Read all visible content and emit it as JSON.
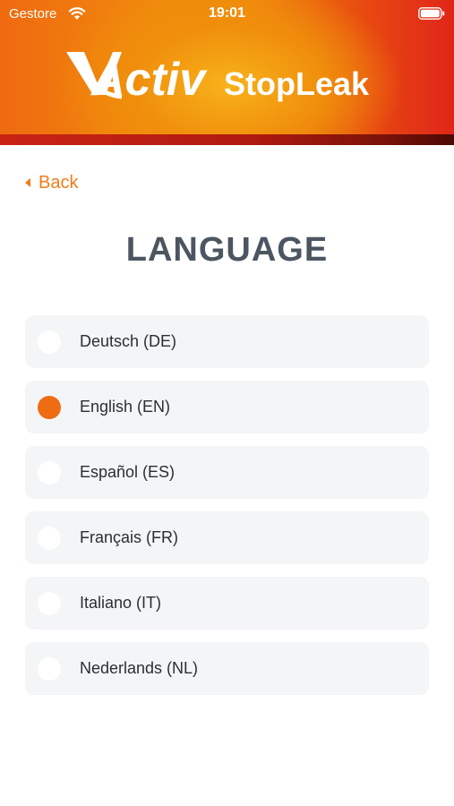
{
  "status_bar": {
    "carrier": "Gestore",
    "time": "19:01"
  },
  "logo": {
    "text_activ": "Activ",
    "text_stopleak": "StopLeak"
  },
  "nav": {
    "back_label": "Back"
  },
  "page": {
    "title": "LANGUAGE"
  },
  "languages": [
    {
      "label": "Deutsch (DE)",
      "selected": false
    },
    {
      "label": "English (EN)",
      "selected": true
    },
    {
      "label": "Español (ES)",
      "selected": false
    },
    {
      "label": "Français (FR)",
      "selected": false
    },
    {
      "label": "Italiano (IT)",
      "selected": false
    },
    {
      "label": "Nederlands (NL)",
      "selected": false
    }
  ],
  "colors": {
    "accent": "#ee6c12",
    "title": "#4b5661",
    "item_bg": "#f4f5f7"
  }
}
